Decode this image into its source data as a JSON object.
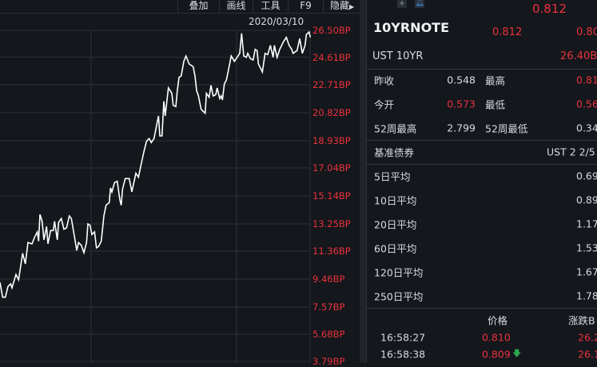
{
  "toolbar": {
    "overlay": "叠加",
    "draw": "画线",
    "tools": "工具",
    "f9": "F9",
    "hide": "隐藏"
  },
  "chart": {
    "date": "2020/03/10",
    "y_labels": [
      "26.50BP",
      "24.61BP",
      "22.71BP",
      "20.82BP",
      "18.93BP",
      "17.04BP",
      "15.14BP",
      "13.25BP",
      "11.36BP",
      "9.46BP",
      "7.57BP",
      "5.68BP",
      "3.79BP"
    ]
  },
  "quote": {
    "top_price": "0.812",
    "symbol": "10YRNOTE",
    "price": "0.812",
    "price2": "0.80",
    "name": "UST 10YR",
    "change": "26.40B"
  },
  "stats": [
    {
      "l1": "昨收",
      "v1": "0.548",
      "l2": "最高",
      "v2": "0.81"
    },
    {
      "l1": "今开",
      "v1": "0.573",
      "l2": "最低",
      "v2": "0.56"
    },
    {
      "l1": "52周最高",
      "v1": "2.799",
      "l2": "52周最低",
      "v2": "0.34"
    }
  ],
  "benchmark": {
    "label": "基准债券",
    "value": "UST 2 2/5"
  },
  "averages": [
    {
      "label": "5日平均",
      "value": "0.69"
    },
    {
      "label": "10日平均",
      "value": "0.89"
    },
    {
      "label": "20日平均",
      "value": "1.17"
    },
    {
      "label": "60日平均",
      "value": "1.53"
    },
    {
      "label": "120日平均",
      "value": "1.67"
    },
    {
      "label": "250日平均",
      "value": "1.78"
    }
  ],
  "ticks": {
    "price_header": "价格",
    "change_header": "涨跌B",
    "rows": [
      {
        "time": "16:58:27",
        "price": "0.810",
        "change": "26.2"
      },
      {
        "time": "16:58:38",
        "price": "0.809",
        "change": "26.1"
      }
    ]
  },
  "colors": {
    "up": "#e8323c",
    "down": "#2aa84a",
    "bg": "#14171c"
  }
}
